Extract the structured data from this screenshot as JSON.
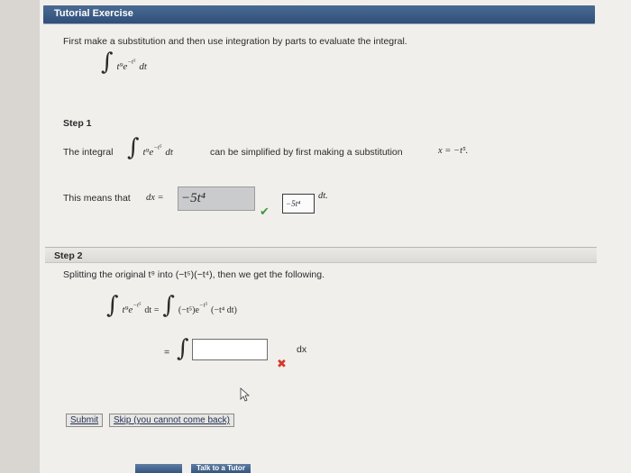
{
  "header": {
    "title": "Tutorial Exercise"
  },
  "problem": {
    "prompt": "First make a substitution and then use integration by parts to evaluate the integral.",
    "integrand": "t⁹e",
    "integrand_exp": "−t⁵",
    "dt": "dt"
  },
  "step1": {
    "title": "Step 1",
    "text_before": "The integral",
    "integrand": "t⁹e",
    "integrand_exp": "−t⁵",
    "dt": "dt",
    "text_after": "can be simplified by first making a substitution",
    "substitution": "x = −t⁵.",
    "means_text": "This means that",
    "dx_label": "dx =",
    "answer_value": "−5t⁴",
    "correct_value": "−5t⁴",
    "dt_suffix": "dt."
  },
  "step2": {
    "title": "Step 2",
    "text": "Splitting the original t⁹ into (−t⁵)(−t⁴), then we get the following.",
    "lhs": "t⁹e",
    "lhs_exp": "−t⁵",
    "lhs_dt": "dt =",
    "rhs": "(−t⁵)e",
    "rhs_exp": "−t⁵",
    "rhs_tail": "(−t⁴ dt)",
    "second_line_prefix": "=",
    "dx": "dx"
  },
  "buttons": {
    "submit": "Submit",
    "skip": "Skip (you cannot come back)",
    "talk_tutor": "Talk to a Tutor"
  }
}
